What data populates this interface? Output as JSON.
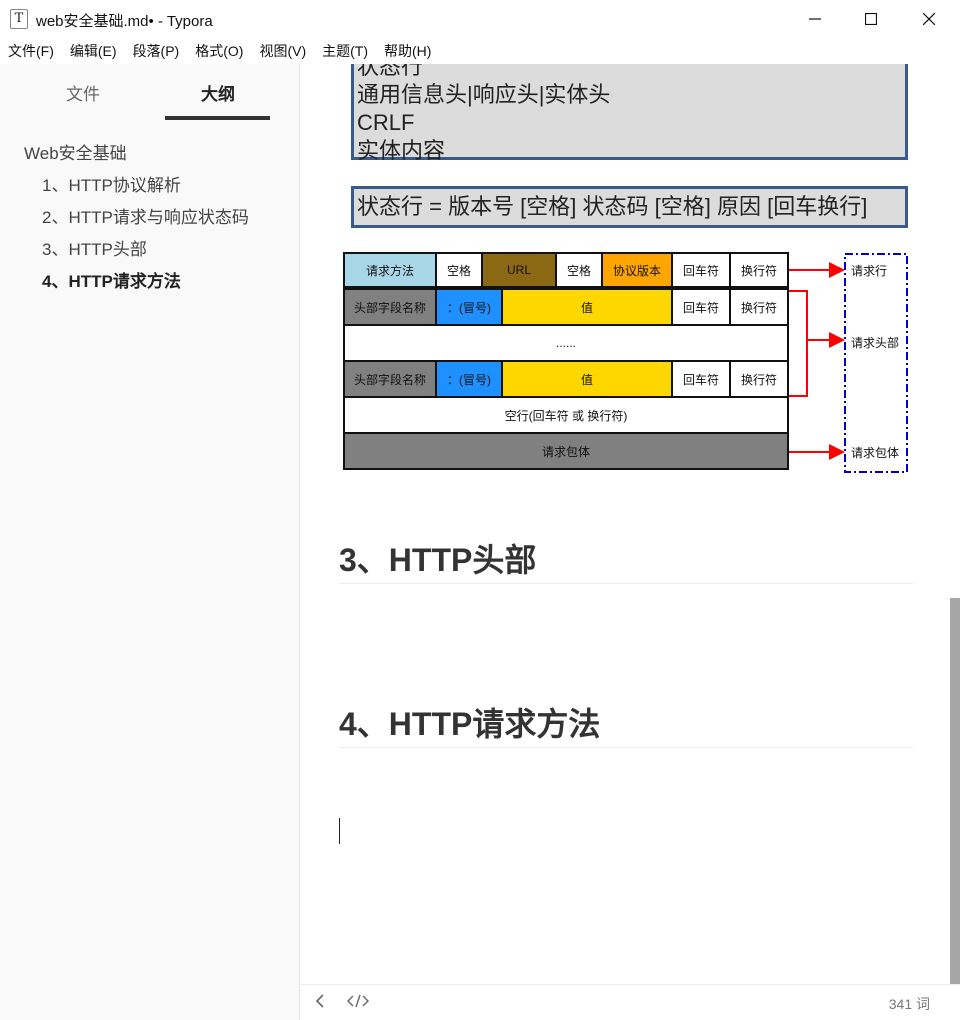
{
  "window": {
    "icon_letter": "T",
    "title": "web安全基础.md• - Typora"
  },
  "menu": [
    "文件(F)",
    "编辑(E)",
    "段落(P)",
    "格式(O)",
    "视图(V)",
    "主题(T)",
    "帮助(H)"
  ],
  "sidebar": {
    "tabs": [
      "文件",
      "大纲"
    ],
    "outline": [
      {
        "label": "Web安全基础"
      },
      {
        "label": "1、HTTP协议解析"
      },
      {
        "label": "2、HTTP请求与响应状态码"
      },
      {
        "label": "3、HTTP头部"
      },
      {
        "label": "4、HTTP请求方法"
      }
    ]
  },
  "editor": {
    "box1_lines": [
      "状态行",
      "通用信息头|响应头|实体头",
      "CRLF",
      "实体内容"
    ],
    "box2_text": "状态行 = 版本号 [空格] 状态码 [空格] 原因 [回车换行]",
    "diagram": {
      "row1": [
        "请求方法",
        "空格",
        "URL",
        "空格",
        "协议版本",
        "回车符",
        "换行符"
      ],
      "row2": [
        "头部字段名称",
        "：(冒号)",
        "值",
        "回车符",
        "换行符"
      ],
      "row3": "......",
      "row4": [
        "头部字段名称",
        "：(冒号)",
        "值",
        "回车符",
        "换行符"
      ],
      "row5": "空行(回车符 或 换行符)",
      "row6": "请求包体",
      "labels": [
        "请求行",
        "请求头部",
        "请求包体"
      ],
      "colors": {
        "method": "#a8d8e8",
        "url": "#8b6914",
        "version": "#ffa500",
        "header": "#808080",
        "colon": "#1e90ff",
        "value": "#ffd700",
        "body": "#808080",
        "arrow": "#ff0000",
        "bracket": "#0000cc"
      }
    },
    "heading3": "3、HTTP头部",
    "heading4": "4、HTTP请求方法"
  },
  "footer": {
    "word_count": "341 词"
  }
}
